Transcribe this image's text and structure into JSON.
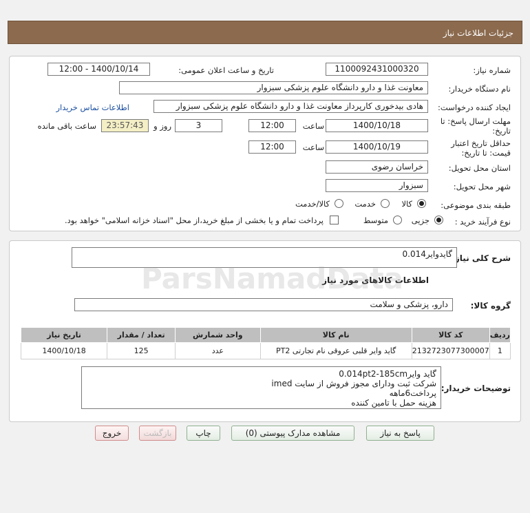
{
  "header": {
    "title": "جزئیات اطلاعات نیاز"
  },
  "form": {
    "need_number_label": "شماره نیاز:",
    "need_number": "1100092431000320",
    "announce_label": "تاریخ و ساعت اعلان عمومی:",
    "announce_value": "1400/10/14 - 12:00",
    "buyer_org_label": "نام دستگاه خریدار:",
    "buyer_org": "معاونت غذا و دارو   دانشگاه علوم پزشکی سبزوار",
    "creator_label": "ایجاد کننده درخواست:",
    "creator": "هادی بیدخوری کارپرداز معاونت غذا و دارو   دانشگاه علوم پزشکی سبزوار",
    "contact_link": "اطلاعات تماس خریدار",
    "deadline_label_1": "مهلت ارسال پاسخ: تا",
    "deadline_label_2": "تاریخ:",
    "deadline_date": "1400/10/18",
    "time_label": "ساعت",
    "deadline_time": "12:00",
    "days_value": "3",
    "days_label": "روز و",
    "remaining_time": "23:57:43",
    "remaining_label": "ساعت باقی مانده",
    "validity_label_1": "حداقل تاریخ اعتبار",
    "validity_label_2": "قیمت: تا تاریخ:",
    "validity_date": "1400/10/19",
    "validity_time": "12:00",
    "province_label": "استان محل تحویل:",
    "province": "خراسان رضوی",
    "city_label": "شهر محل تحویل:",
    "city": "سبزوار",
    "category_label": "طبقه بندی موضوعی:",
    "category_options": [
      "کالا",
      "خدمت",
      "کالا/خدمت"
    ],
    "process_label": "نوع فرآیند خرید :",
    "process_options": [
      "جزیی",
      "متوسط"
    ],
    "payment_note": "پرداخت تمام و یا بخشی از مبلغ خرید،از محل \"اسناد خزانه اسلامی\" خواهد بود."
  },
  "summary": {
    "label": "شرح کلی نیاز:",
    "value": "گایدوایر0.014",
    "goods_info_title": "اطلاعات کالاهای مورد نیاز",
    "group_label": "گروه کالا:",
    "group_value": "دارو، پزشکی و سلامت"
  },
  "table": {
    "headers": [
      "ردیف",
      "کد کالا",
      "نام کالا",
      "واحد شمارش",
      "تعداد / مقدار",
      "تاریخ نیاز"
    ],
    "rows": [
      [
        "1",
        "2132723077300007",
        "گاید وایر قلبی عروقی نام تجارتی PT2",
        "عدد",
        "125",
        "1400/10/18"
      ]
    ]
  },
  "notes": {
    "label": "توضیحات خریدار:",
    "lines": [
      "گاید وایر0.014pt2-185cm",
      "شرکت ثبت ودارای مجوز فروش از سایت imed",
      "پرداخت6ماهه",
      "هزینه حمل با تامین کننده"
    ]
  },
  "buttons": {
    "reply": "پاسخ به نیاز",
    "attachments": "مشاهده مدارک پیوستی (0)",
    "print": "چاپ",
    "back": "بازگشت",
    "exit": "خروج"
  }
}
